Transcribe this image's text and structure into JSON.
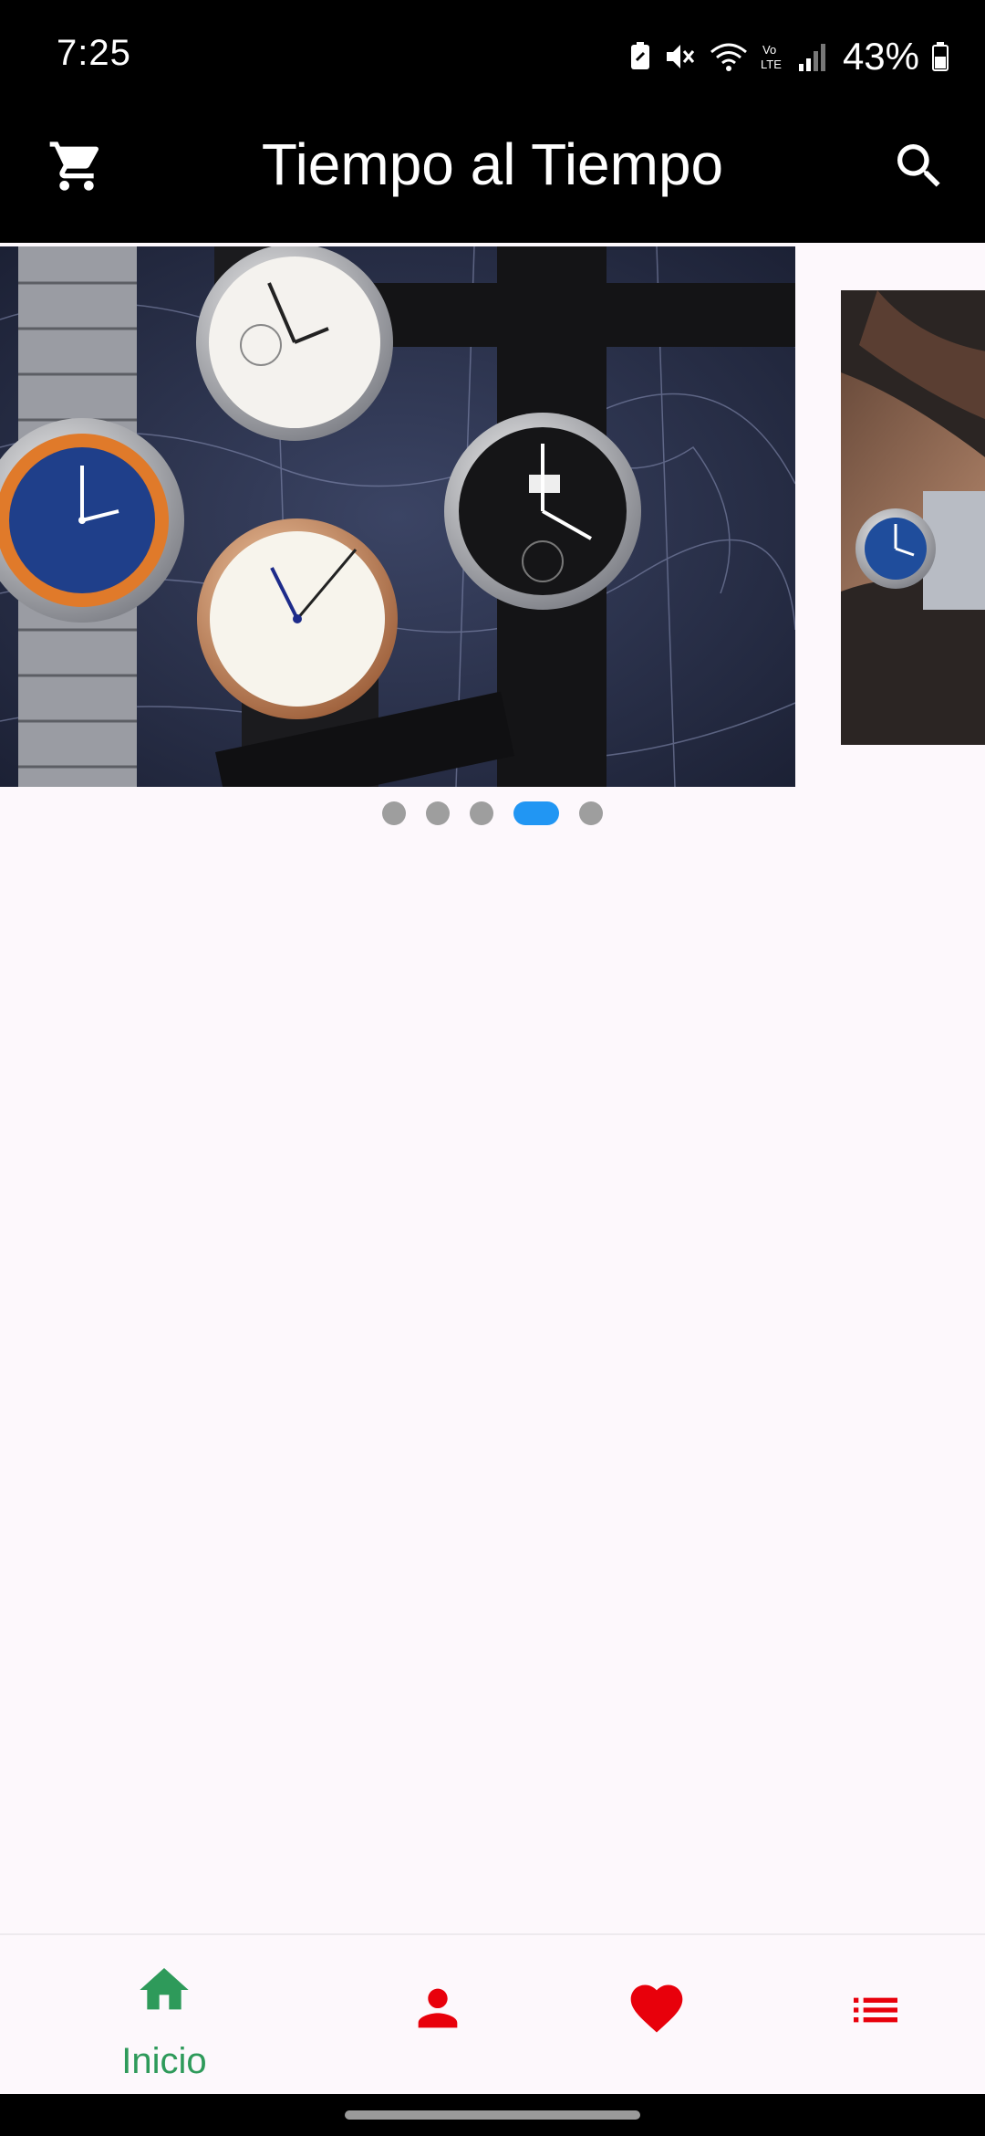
{
  "status_bar": {
    "time": "7:25",
    "battery": "43%"
  },
  "app_bar": {
    "title": "Tiempo al Tiempo",
    "cart_icon": "cart-icon",
    "search_icon": "search-icon"
  },
  "carousel": {
    "slide_count": 5,
    "active_index": 3
  },
  "bottom_nav": {
    "items": [
      {
        "label": "Inicio",
        "icon": "home-icon",
        "active": true
      },
      {
        "label": "",
        "icon": "person-icon",
        "active": false
      },
      {
        "label": "",
        "icon": "heart-icon",
        "active": false
      },
      {
        "label": "",
        "icon": "list-icon",
        "active": false
      }
    ]
  },
  "colors": {
    "active": "#2e9a5a",
    "inactive": "#e8000b",
    "dot_active": "#2196f3",
    "dot": "#9e9e9e"
  }
}
